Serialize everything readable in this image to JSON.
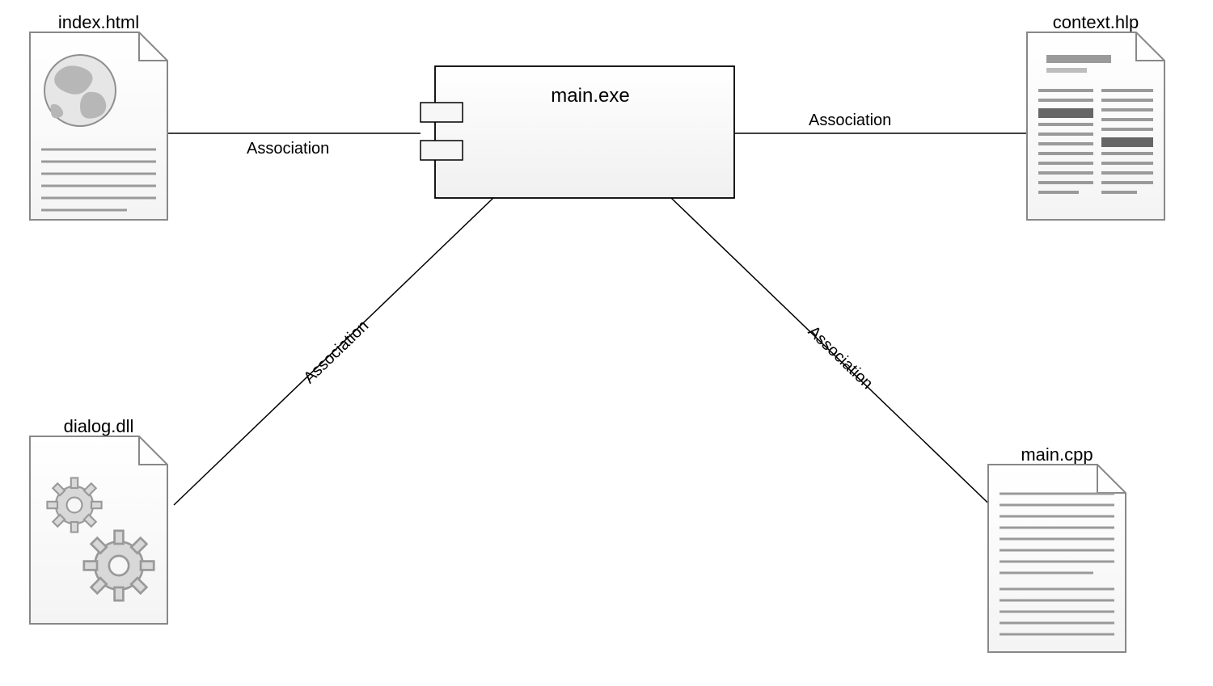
{
  "diagram": {
    "type": "uml-component",
    "component": {
      "name": "main.exe"
    },
    "artifacts": [
      {
        "id": "index",
        "label": "index.html",
        "icon": "html"
      },
      {
        "id": "context",
        "label": "context.hlp",
        "icon": "help"
      },
      {
        "id": "dialog",
        "label": "dialog.dll",
        "icon": "dll"
      },
      {
        "id": "maincpp",
        "label": "main.cpp",
        "icon": "text"
      }
    ],
    "edges": [
      {
        "from": "component",
        "to": "index",
        "label": "Association"
      },
      {
        "from": "component",
        "to": "context",
        "label": "Association"
      },
      {
        "from": "component",
        "to": "dialog",
        "label": "Association"
      },
      {
        "from": "component",
        "to": "maincpp",
        "label": "Association"
      }
    ]
  }
}
